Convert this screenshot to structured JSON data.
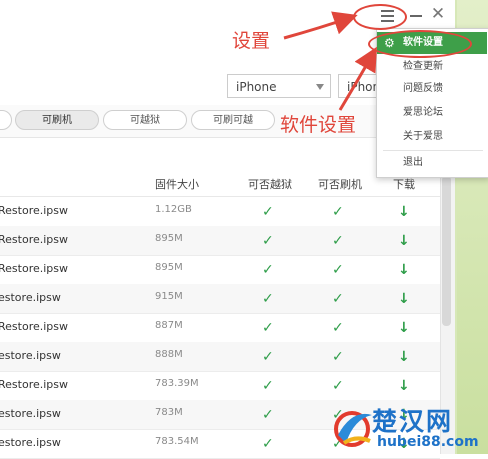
{
  "device_select": {
    "value": "iPhone"
  },
  "model_select": {
    "value": "iPhone"
  },
  "filters": [
    "可刷机",
    "可越狱",
    "可刷可越"
  ],
  "table": {
    "headers": {
      "size": "固件大小",
      "jailbreak": "可否越狱",
      "flash": "可否刷机",
      "download": "下载"
    },
    "rows": [
      {
        "name": "Restore.ipsw",
        "size": "1.12GB"
      },
      {
        "name": "Restore.ipsw",
        "size": "895M"
      },
      {
        "name": "Restore.ipsw",
        "size": "895M"
      },
      {
        "name": "estore.ipsw",
        "size": "915M"
      },
      {
        "name": "Restore.ipsw",
        "size": "887M"
      },
      {
        "name": "estore.ipsw",
        "size": "888M"
      },
      {
        "name": "Restore.ipsw",
        "size": "783.39M"
      },
      {
        "name": "estore.ipsw",
        "size": "783M"
      },
      {
        "name": "estore.ipsw",
        "size": "783.54M"
      }
    ],
    "check_glyph": "✓",
    "download_glyph": "↓"
  },
  "menu": {
    "items": [
      "软件设置",
      "检查更新",
      "问题反馈",
      "爱思论坛",
      "关于爱思"
    ],
    "exit": "退出"
  },
  "window_controls": {
    "close": "✕"
  },
  "annotations": {
    "settings": "设置",
    "software_settings": "软件设置"
  },
  "watermark": {
    "name": "楚汉网",
    "url": "hubei88.com"
  },
  "colors": {
    "accent_green": "#3e9f49",
    "annotation_red": "#e0463b",
    "watermark_blue": "#1e72c8"
  }
}
